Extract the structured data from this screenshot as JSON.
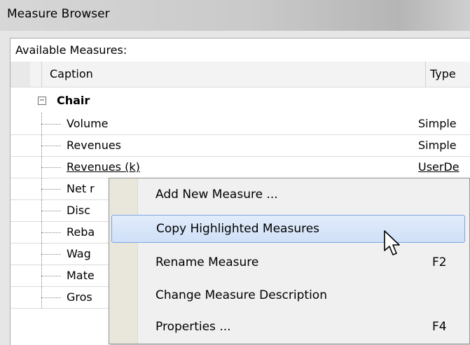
{
  "window": {
    "title": "Measure Browser"
  },
  "panel": {
    "available_label": "Available Measures:"
  },
  "grid": {
    "columns": {
      "caption": "Caption",
      "type": "Type"
    },
    "group": {
      "name": "Chair",
      "toggle": "−"
    },
    "rows": [
      {
        "caption": "Volume",
        "type": "Simple"
      },
      {
        "caption": "Revenues",
        "type": "Simple"
      },
      {
        "caption": "Revenues (k)",
        "type": "UserDe"
      },
      {
        "caption": "Net r",
        "type": ""
      },
      {
        "caption": "Disc",
        "type": ""
      },
      {
        "caption": "Reba",
        "type": ""
      },
      {
        "caption": "Wag",
        "type": ""
      },
      {
        "caption": "Mate",
        "type": ""
      },
      {
        "caption": "Gros",
        "type": ""
      }
    ]
  },
  "context_menu": {
    "items": [
      {
        "label": "Add New Measure ...",
        "shortcut": ""
      },
      {
        "label": "Copy Highlighted Measures",
        "shortcut": ""
      },
      {
        "label": "Rename Measure",
        "shortcut": "F2"
      },
      {
        "label": "Change Measure Description",
        "shortcut": ""
      },
      {
        "label": "Properties ...",
        "shortcut": "F4"
      }
    ],
    "highlighted_index": 1
  }
}
